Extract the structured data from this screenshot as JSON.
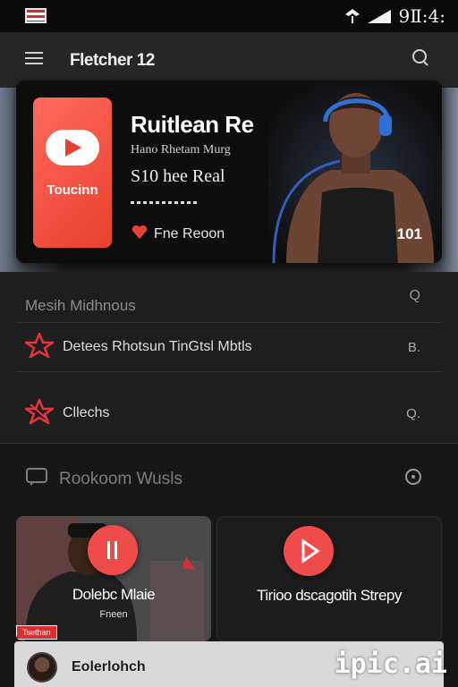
{
  "status_bar": {
    "time": "9Ⅱ:4:"
  },
  "app_bar": {
    "title": "Fletcher 12"
  },
  "hero": {
    "logo_text": "Toucinn",
    "title": "Ruitlean Re",
    "subtitle": "Hano Rhetam Murg",
    "meta": "S10 hee Real",
    "link_label": "Fne Reoon",
    "count": "101"
  },
  "list_section": {
    "header": "Mesih Midhnous",
    "header_right": "Q",
    "items": [
      {
        "label": "Detees Rhotsun TinGtsl Mbtls",
        "tail": "B."
      },
      {
        "label": "Cllechs",
        "tail": "Q."
      }
    ]
  },
  "section2": {
    "header": "Rookoom Wusls"
  },
  "tiles": [
    {
      "title": "Dolebc Mlaie",
      "subtitle": "Fneen",
      "badge": "Tsethan"
    },
    {
      "title": "Tirioo dscagotih Strepy"
    }
  ],
  "bottom_bar": {
    "label": "Eolerlohch"
  },
  "watermark": "ipic.ai",
  "colors": {
    "accent": "#ef4b4b",
    "background": "#171717",
    "card": "#0d0d0d"
  }
}
